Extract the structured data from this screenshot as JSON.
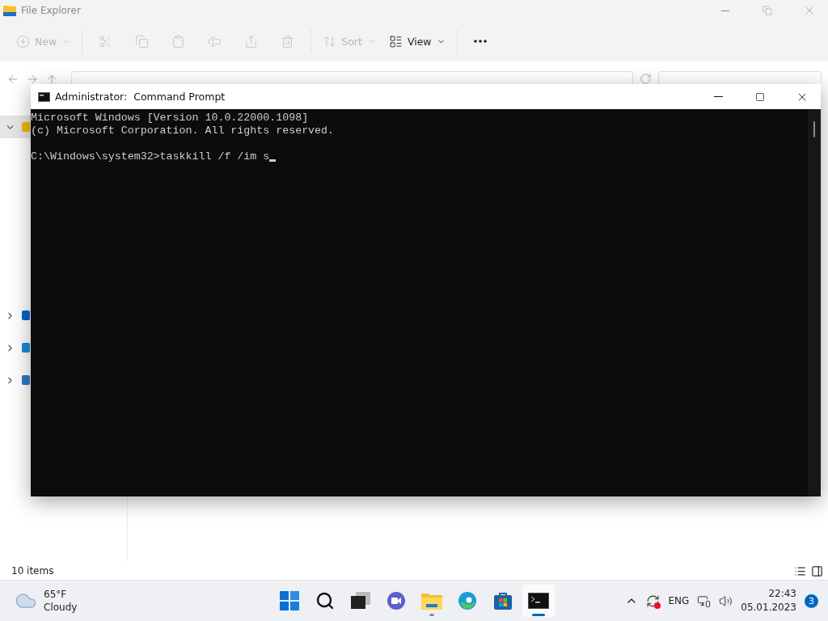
{
  "explorer": {
    "title": "File Explorer",
    "toolbar": [
      {
        "kind": "new",
        "label": "New",
        "disabled": true
      },
      {
        "kind": "cut",
        "disabled": true
      },
      {
        "kind": "copy",
        "disabled": true
      },
      {
        "kind": "paste",
        "disabled": true
      },
      {
        "kind": "rename",
        "disabled": true
      },
      {
        "kind": "share",
        "disabled": true
      },
      {
        "kind": "delete",
        "disabled": true
      },
      {
        "kind": "sort",
        "label": "Sort",
        "disabled": true
      },
      {
        "kind": "view",
        "label": "View",
        "disabled": false
      },
      {
        "kind": "more",
        "disabled": false
      }
    ],
    "sidebar": [
      {
        "kind": "quick",
        "expanded": true,
        "selected": true
      },
      {
        "kind": "cloud",
        "expanded": false,
        "selected": false
      },
      {
        "kind": "pc",
        "expanded": false,
        "selected": false
      },
      {
        "kind": "network",
        "expanded": false,
        "selected": false
      }
    ],
    "status_text": "10 items"
  },
  "console": {
    "title": "Administrator:  Command Prompt",
    "lines": [
      {
        "text": "Microsoft Windows [Version 10.0.22000.1098]"
      },
      {
        "text": "(c) Microsoft Corporation. All rights reserved."
      },
      {
        "text": "C:\\Windows\\system32>taskkill /f /im s",
        "cursor": true
      }
    ]
  },
  "taskbar": {
    "weather": {
      "temperature": "65°F",
      "condition": "Cloudy"
    },
    "apps": [
      {
        "kind": "start",
        "running": false,
        "selected": false
      },
      {
        "kind": "search",
        "running": false,
        "selected": false
      },
      {
        "kind": "taskview",
        "running": false,
        "selected": false
      },
      {
        "kind": "chat",
        "running": false,
        "selected": false
      },
      {
        "kind": "explorer",
        "running": true,
        "selected": false
      },
      {
        "kind": "edge",
        "running": false,
        "selected": false
      },
      {
        "kind": "store",
        "running": false,
        "selected": false
      },
      {
        "kind": "terminal",
        "running": true,
        "selected": true
      }
    ],
    "language": "ENG",
    "time": "22:43",
    "date": "05.01.2023",
    "notifications": "3"
  }
}
